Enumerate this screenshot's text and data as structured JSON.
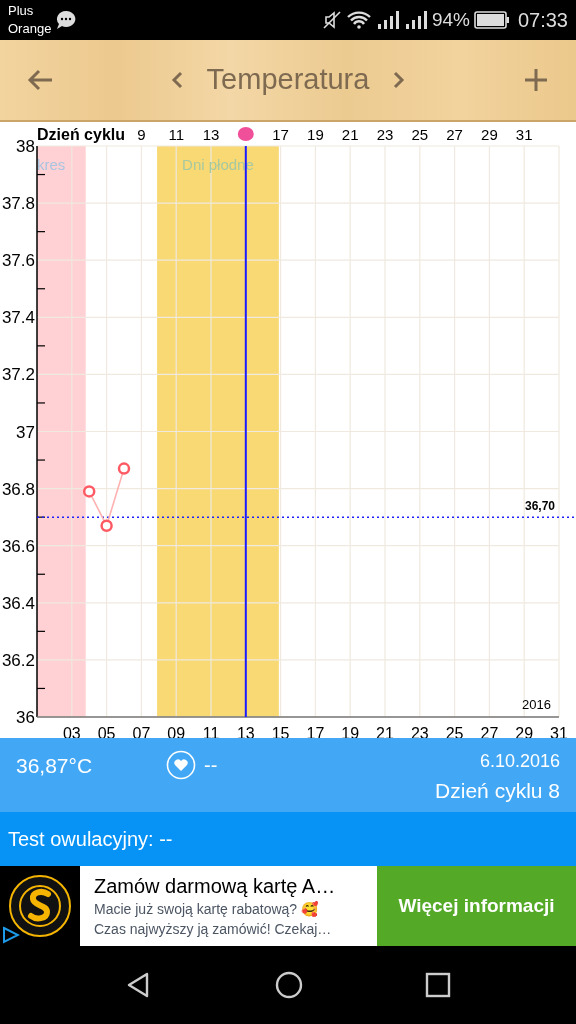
{
  "status_bar": {
    "carrier": [
      "Plus",
      "Orange"
    ],
    "battery": "94%",
    "time": "07:33"
  },
  "header": {
    "title": "Temperatura"
  },
  "chart": {
    "cycle_axis": {
      "title": "Dzień cyklu",
      "ticks": [
        {
          "kind": "label",
          "label": "9"
        },
        {
          "kind": "label",
          "label": "11"
        },
        {
          "kind": "label",
          "label": "13"
        },
        {
          "kind": "marker",
          "color": "#f0509a"
        },
        {
          "kind": "label",
          "label": "17"
        },
        {
          "kind": "label",
          "label": "19"
        },
        {
          "kind": "label",
          "label": "21"
        },
        {
          "kind": "label",
          "label": "23"
        },
        {
          "kind": "label",
          "label": "25"
        },
        {
          "kind": "label",
          "label": "27"
        },
        {
          "kind": "label",
          "label": "29"
        },
        {
          "kind": "label",
          "label": "31"
        }
      ]
    },
    "year": "2016",
    "chart_data": {
      "type": "line",
      "x": [
        4,
        5,
        6
      ],
      "series": [
        {
          "color": "#ff5a64",
          "marker": "o",
          "values": [
            36.79,
            36.67,
            36.87
          ]
        }
      ],
      "grid": true,
      "xlim": [
        1,
        31
      ],
      "ylim": [
        36,
        38
      ],
      "xticks": [
        {
          "value": 3,
          "label": "03"
        },
        {
          "value": 5,
          "label": "05"
        },
        {
          "value": 7,
          "label": "07"
        },
        {
          "value": 9,
          "label": "09"
        },
        {
          "value": 11,
          "label": "11"
        },
        {
          "value": 13,
          "label": "13"
        },
        {
          "value": 15,
          "label": "15"
        },
        {
          "value": 17,
          "label": "17"
        },
        {
          "value": 19,
          "label": "19"
        },
        {
          "value": 21,
          "label": "21"
        },
        {
          "value": 23,
          "label": "23"
        },
        {
          "value": 25,
          "label": "25"
        },
        {
          "value": 27,
          "label": "27"
        },
        {
          "value": 29,
          "label": "29"
        },
        {
          "value": 31,
          "label": "31"
        }
      ],
      "yticks": [
        {
          "value": 36,
          "label": "36"
        },
        {
          "value": 36.2,
          "label": "36.2"
        },
        {
          "value": 36.4,
          "label": "36.4"
        },
        {
          "value": 36.6,
          "label": "36.6"
        },
        {
          "value": 36.8,
          "label": "36.8"
        },
        {
          "value": 37,
          "label": "37"
        },
        {
          "value": 37.2,
          "label": "37.2"
        },
        {
          "value": 37.4,
          "label": "37.4"
        },
        {
          "value": 37.6,
          "label": "37.6"
        },
        {
          "value": 37.8,
          "label": "37.8"
        },
        {
          "value": 38,
          "label": "38"
        }
      ],
      "bands": [
        {
          "axis": "x",
          "from": 1,
          "to": 3.8,
          "color": "#ffd1d4",
          "label": "kres"
        },
        {
          "axis": "x",
          "from": 7.9,
          "to": 14.9,
          "color": "#f8d973",
          "label": "Dni płodne"
        }
      ],
      "ref_lines": [
        {
          "axis": "x",
          "value": 13,
          "color": "#1a1aff"
        },
        {
          "axis": "y",
          "value": 36.7,
          "color": "#2020ff",
          "label": "36,70"
        }
      ]
    }
  },
  "info": {
    "temperature": "36,87°C",
    "mark": "--",
    "date": "6.10.2016",
    "cycle_day": "Dzień cyklu 8"
  },
  "test": {
    "label": "Test owulacyjny: --"
  },
  "ad": {
    "title": "Zamów darmową kartę A…",
    "lines": [
      "Macie już swoją kartę rabatową? 🥰",
      "Czas najwyższy ją zamówić! Czekaj…"
    ],
    "button": "Więcej informacji"
  }
}
